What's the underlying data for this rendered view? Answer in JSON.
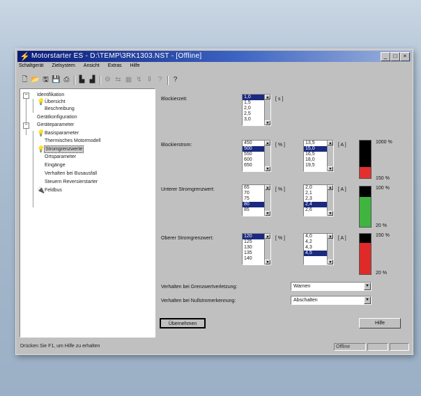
{
  "window": {
    "title": "Motorstarter ES - D:\\TEMP\\3RK1303.NST - [Offline]",
    "controls": [
      "_",
      "□",
      "×"
    ]
  },
  "menu": [
    "Schaltgerät",
    "Zielsystem",
    "Ansicht",
    "Extras",
    "Hilfe"
  ],
  "toolbar": {
    "icons": [
      "new-icon",
      "open-icon",
      "save-as-icon",
      "save-icon",
      "print-icon",
      "load-to-pc-icon",
      "load-to-device-icon",
      "online-icon",
      "compare-icon",
      "monitor-icon",
      "test-icon",
      "id-icon",
      "help-context-icon",
      "info-icon"
    ]
  },
  "tree": [
    {
      "label": "Identifikation",
      "level": 0,
      "expander": "-"
    },
    {
      "label": "Übersicht",
      "level": 1,
      "icon": "bulb"
    },
    {
      "label": "Beschreibung",
      "level": 1
    },
    {
      "label": "Gerätkonfiguration",
      "level": 0
    },
    {
      "label": "Geräteparameter",
      "level": 0,
      "expander": "-"
    },
    {
      "label": "Basisparameter",
      "level": 1,
      "icon": "bulb"
    },
    {
      "label": "Thermisches Motormodell",
      "level": 1
    },
    {
      "label": "Stromgrenzwerte",
      "level": 1,
      "icon": "bulb",
      "selected": true
    },
    {
      "label": "Ortsparameter",
      "level": 1
    },
    {
      "label": "Eingänge",
      "level": 1
    },
    {
      "label": "Verhalten bei Busausfall",
      "level": 1
    },
    {
      "label": "Steuern Reversierstarter",
      "level": 1
    },
    {
      "label": "Feldbus",
      "level": 1,
      "icon": "plug"
    }
  ],
  "panel": {
    "blockierzeit": {
      "label": "Blockierzeit:",
      "items": [
        "1,0",
        "1,5",
        "2,0",
        "2,5",
        "3,0"
      ],
      "selected": 0,
      "unit": "[ s ]"
    },
    "blockierstrom": {
      "label": "Blockierstrom:",
      "pct_items": [
        "450",
        "500",
        "550",
        "600",
        "650"
      ],
      "pct_selected": 1,
      "pct_unit": "[ % ]",
      "amp_items": [
        "13,5",
        "15,0",
        "16,5",
        "18,0",
        "19,5"
      ],
      "amp_selected": 1,
      "amp_unit": "[ A ]",
      "bar_color": "#e23030",
      "bar_fill": 0.29,
      "bar_top": "1000 %",
      "bar_bottom": "150 %"
    },
    "unterer": {
      "label": "Unterer Stromgrenzwert:",
      "pct_items": [
        "65",
        "70",
        "75",
        "80",
        "85"
      ],
      "pct_selected": 3,
      "pct_unit": "[ % ]",
      "amp_items": [
        "2,0",
        "2,1",
        "2,3",
        "2,4",
        "2,6"
      ],
      "amp_selected": 3,
      "amp_unit": "[ A ]",
      "bar_color": "#3fb53f",
      "bar_fill": 0.75,
      "bar_top": "100 %",
      "bar_bottom": "20 %"
    },
    "oberer": {
      "label": "Oberer Stromgrenzwert:",
      "pct_items": [
        "120",
        "125",
        "130",
        "135",
        "140"
      ],
      "pct_selected": 0,
      "pct_unit": "[ % ]",
      "amp_items": [
        "4,0",
        "4,2",
        "4,3",
        "4,5",
        ""
      ],
      "amp_selected": 3,
      "amp_unit": "[ A ]",
      "bar_color": "#e02a2a",
      "bar_fill": 0.77,
      "bar_top": "150 %",
      "bar_bottom": "20 %"
    },
    "verhalten_grenz": {
      "label": "Verhalten bei Grenzwertverletzung:",
      "value": "Warnen"
    },
    "verhalten_null": {
      "label": "Verhalten bei Nullstromerkennung:",
      "value": "Abschalten"
    },
    "apply_label": "Übernehmen",
    "help_label": "Hilfe"
  },
  "status": {
    "hint": "Drücken Sie F1, um Hilfe zu erhalten",
    "mode": "Offline"
  }
}
